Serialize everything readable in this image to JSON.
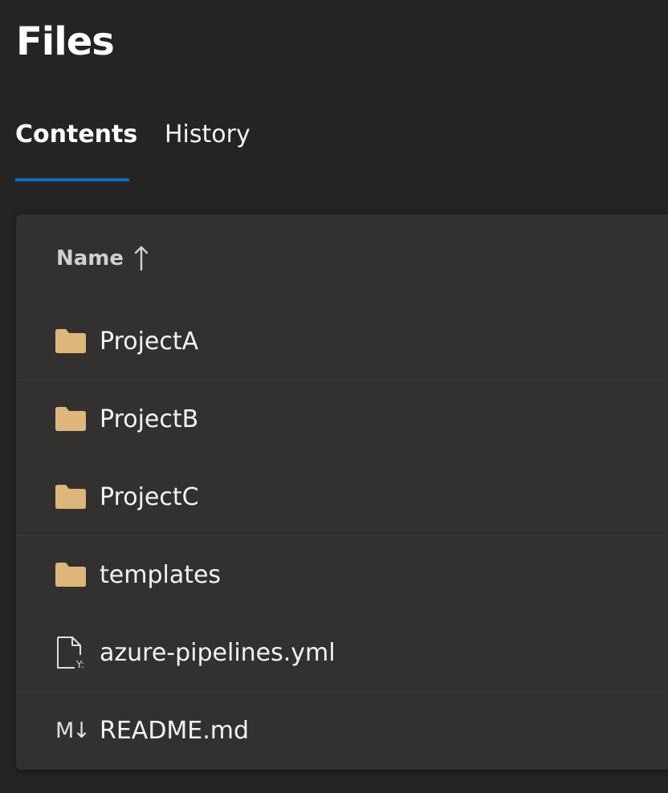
{
  "page": {
    "title": "Files"
  },
  "tabs": [
    {
      "label": "Contents",
      "selected": true
    },
    {
      "label": "History",
      "selected": false
    }
  ],
  "table": {
    "column_header": "Name",
    "sort_direction": "ascending",
    "rows": [
      {
        "name": "ProjectA",
        "icon": "folder-icon"
      },
      {
        "name": "ProjectB",
        "icon": "folder-icon"
      },
      {
        "name": "ProjectC",
        "icon": "folder-icon"
      },
      {
        "name": "templates",
        "icon": "folder-icon"
      },
      {
        "name": "azure-pipelines.yml",
        "icon": "yaml-file-icon"
      },
      {
        "name": "README.md",
        "icon": "markdown-icon",
        "icon_text": "M↓"
      }
    ]
  },
  "colors": {
    "background": "#252423",
    "card": "#323130",
    "accent": "#0f6cbd",
    "folder": "#dcb67a"
  }
}
